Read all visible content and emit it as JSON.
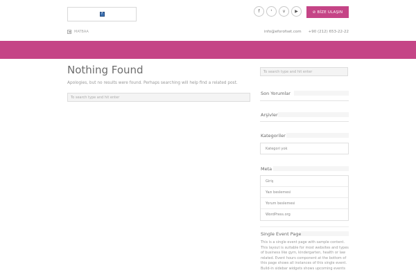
{
  "header": {
    "logo_glyph": "?",
    "social_icons": [
      {
        "name": "facebook-icon",
        "glyph": "f"
      },
      {
        "name": "twitter-icon",
        "glyph": "ᵗ"
      },
      {
        "name": "vimeo-icon",
        "glyph": "v"
      },
      {
        "name": "youtube-icon",
        "glyph": "▶"
      }
    ],
    "cta_icon": "⊘",
    "cta_label": "BİZE ULAŞIN",
    "topline_label": "MATBAA",
    "email": "info@eforofset.com",
    "phone": "+90 (212) 653-22-22",
    "brand_color": "#c54486"
  },
  "main": {
    "title": "Nothing Found",
    "text": "Apologies, but no results were found. Perhaps searching will help find a related post.",
    "search_placeholder": "To search type and hit enter"
  },
  "sidebar": {
    "search_placeholder": "To search type and hit enter",
    "recent_comments_title": "Son Yorumlar",
    "archives_title": "Arşivler",
    "categories_title": "Kategoriler",
    "categories_empty": "Kategori yok",
    "meta_title": "Meta",
    "meta_items": [
      "Giriş",
      "Yazı beslemesi",
      "Yorum beslemesi",
      "WordPress.org"
    ],
    "event_title": "Single Event Page",
    "event_text": "This is a single event page with sample content. This layout is suitable for most websites and types of business like gym, kindergarten, health or law related. Event hours component at the bottom of this page shows all instances of this single event. Build-in sidebar widgets shows upcoming events"
  }
}
